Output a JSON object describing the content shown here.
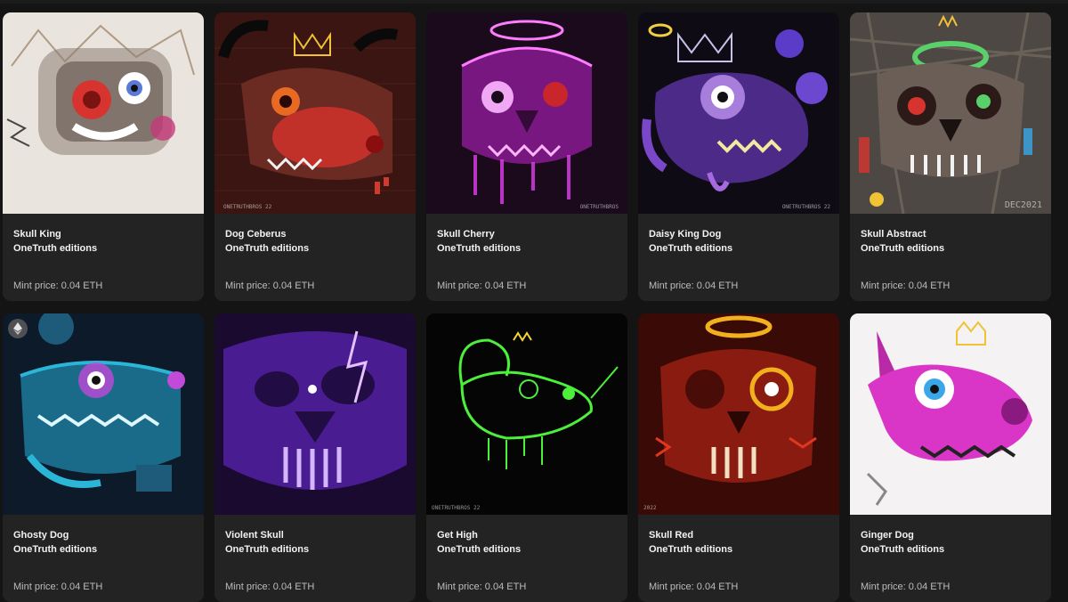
{
  "gallery": {
    "items": [
      {
        "title": "Skull King",
        "creator": "OneTruth editions",
        "price": "Mint price: 0.04 ETH",
        "bg": "#e9e4dd",
        "accent": "#d8342f",
        "glow": "#5a7ad8",
        "signature": "",
        "eth_badge": false
      },
      {
        "title": "Dog Ceberus",
        "creator": "OneTruth editions",
        "price": "Mint price: 0.04 ETH",
        "bg": "#3a1512",
        "accent": "#c2302a",
        "glow": "#f0c234",
        "signature": "ONETRUTHBROS 22",
        "eth_badge": false
      },
      {
        "title": "Skull Cherry",
        "creator": "OneTruth editions",
        "price": "Mint price: 0.04 ETH",
        "bg": "#1a0a1c",
        "accent": "#e23ef0",
        "glow": "#ff7cff",
        "signature": "ONETRUTHBROS",
        "eth_badge": false
      },
      {
        "title": "Daisy King Dog",
        "creator": "OneTruth editions",
        "price": "Mint price: 0.04 ETH",
        "bg": "#0f0b14",
        "accent": "#7b47c9",
        "glow": "#cfa3ff",
        "signature": "ONETRUTHBROS 22",
        "eth_badge": false
      },
      {
        "title": "Skull Abstract",
        "creator": "OneTruth editions",
        "price": "Mint price: 0.04 ETH",
        "bg": "#4d4843",
        "accent": "#c9c0b8",
        "glow": "#5ad06a",
        "signature": "DEC2021",
        "eth_badge": false
      },
      {
        "title": "Ghosty Dog",
        "creator": "OneTruth editions",
        "price": "Mint price: 0.04 ETH",
        "bg": "#0c1a2a",
        "accent": "#2bb5d6",
        "glow": "#c14ad8",
        "signature": "",
        "eth_badge": true
      },
      {
        "title": "Violent Skull",
        "creator": "OneTruth editions",
        "price": "Mint price: 0.04 ETH",
        "bg": "#1b0a2f",
        "accent": "#6a2fc9",
        "glow": "#d4b6ff",
        "signature": "",
        "eth_badge": false
      },
      {
        "title": "Get High",
        "creator": "OneTruth editions",
        "price": "Mint price: 0.04 ETH",
        "bg": "#050505",
        "accent": "#4cf03a",
        "glow": "#f5d534",
        "signature": "ONETRUTHBROS 22",
        "eth_badge": false
      },
      {
        "title": "Skull Red",
        "creator": "OneTruth editions",
        "price": "Mint price: 0.04 ETH",
        "bg": "#3a0a06",
        "accent": "#e0371f",
        "glow": "#f2b01d",
        "signature": "2022",
        "eth_badge": false
      },
      {
        "title": "Ginger Dog",
        "creator": "OneTruth editions",
        "price": "Mint price: 0.04 ETH",
        "bg": "#f4f2f2",
        "accent": "#d936c8",
        "glow": "#3aa7e8",
        "signature": "",
        "eth_badge": false
      }
    ]
  }
}
